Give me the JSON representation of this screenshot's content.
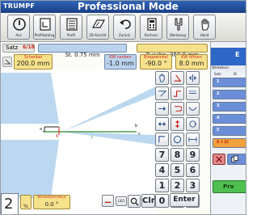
{
  "header": {
    "brand": "TRUMPF",
    "title": "Professional Mode"
  },
  "toolbar": [
    {
      "name": "power",
      "label": "Aus"
    },
    {
      "name": "profile",
      "label": "Profilkatalog"
    },
    {
      "name": "program",
      "label": "Profil"
    },
    {
      "name": "3d",
      "label": "3D-Ansicht"
    },
    {
      "name": "back",
      "label": "Zurück"
    },
    {
      "name": "calc",
      "label": "Rechner"
    },
    {
      "name": "tools",
      "label": "Werkzeug"
    },
    {
      "name": "hand",
      "label": "Hand"
    }
  ],
  "info": {
    "satz_label": "Satz",
    "satz_value": "6/18",
    "st_value": "St. 0.75 mm",
    "zuschn_value": "Zuschn. 360.0 mm",
    "schenkel_label": "Schenkel",
    "schenkel_value": "200.0 mm",
    "kw_senken_label": "KW senken",
    "kw_senken_value": "-1.0 mm",
    "biegewinkel_label": "Biegewinkel",
    "biegewinkel_value": "-90.0 °",
    "kw_offnen_label": "KW öffnen",
    "kw_offnen_value": "8.0 mm"
  },
  "drawing": {
    "label_a": "a",
    "label_b": "b",
    "label_c": "c",
    "label_f": "f",
    "label_6": "6"
  },
  "keypad": {
    "digits": [
      "7",
      "8",
      "9",
      "4",
      "5",
      "6",
      "1",
      "2",
      "3",
      "0",
      ".",
      "+/-"
    ],
    "clr": "Clr",
    "enter": "Enter"
  },
  "bottom": {
    "index": "2",
    "percent_value": "%",
    "winkel_label": "Winkelkorrektur",
    "winkel_value": "0.0 °",
    "geo_label": "GEO"
  },
  "right_panel": {
    "top_label": "E",
    "header_label": "Winkelkorr.",
    "col_a": "Satz",
    "col_b": "Bi",
    "rows": [
      "1",
      "2",
      "3",
      "4",
      "5",
      "6"
    ],
    "selected_row_text": "6 r 2(",
    "pr_label": "Pro"
  },
  "colors": {
    "title_blue": "#1c3f86",
    "yellow": "#f7e28c",
    "highlight_red": "#d12a1a",
    "row_blue": "#6a8fd8",
    "row_selected": "#f2a13a",
    "shade": "#bcd8f0"
  }
}
